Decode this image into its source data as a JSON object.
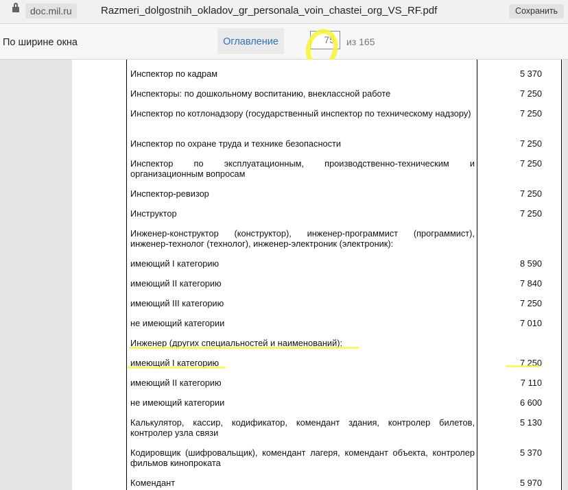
{
  "browser": {
    "domain": "doc.mil.ru",
    "filename": "Razmeri_dolgostnih_okladov_gr_personala_voin_chastei_org_VS_RF.pdf",
    "save_label": "Сохранить"
  },
  "viewer": {
    "zoom_mode": "По ширине окна",
    "toc_label": "Оглавление",
    "current_page": "75",
    "total_pages": "из 165"
  },
  "rows": [
    {
      "label": "Инспектор по кадрам",
      "value": "5 370"
    },
    {
      "label": "Инспекторы: по дошкольному воспитанию, внеклассной работе",
      "value": "7 250"
    },
    {
      "label": "Инспектор по котлонадзору (государственный инспектор по техническому надзору)",
      "value": "7 250"
    },
    {
      "label": "Инспектор по охране труда и технике безопасности",
      "value": "7 250"
    },
    {
      "label": "Инспектор по эксплуатационным, производственно-техническим и организационным вопросам",
      "value": "7 250"
    },
    {
      "label": "Инспектор-ревизор",
      "value": "7 250"
    },
    {
      "label": "Инструктор",
      "value": "7 250"
    },
    {
      "label": "Инженер-конструктор (конструктор), инженер-программист (программист), инженер-технолог (технолог), инженер-электроник (электроник):",
      "value": ""
    },
    {
      "label": "имеющий I категорию",
      "value": "8 590"
    },
    {
      "label": "имеющий II категорию",
      "value": "7 840"
    },
    {
      "label": "имеющий III категорию",
      "value": "7 250"
    },
    {
      "label": "не имеющий категории",
      "value": "7 010"
    },
    {
      "label": "Инженер (других специальностей и наименований):",
      "value": ""
    },
    {
      "label": "имеющий I категорию",
      "value": "7 250"
    },
    {
      "label": "имеющий II категорию",
      "value": "7 110"
    },
    {
      "label": "не имеющий категории",
      "value": "6 600"
    },
    {
      "label": "Калькулятор, кассир, кодификатор, комендант здания, контролер билетов, контролер узла связи",
      "value": "5 130"
    },
    {
      "label": "Кодировщик (шифровальщик), комендант лагеря, комендант объекта, контролер фильмов кинопроката",
      "value": "5 370"
    },
    {
      "label": "Комендант",
      "value": "5 970"
    }
  ],
  "highlight_color": "#f7f53a"
}
